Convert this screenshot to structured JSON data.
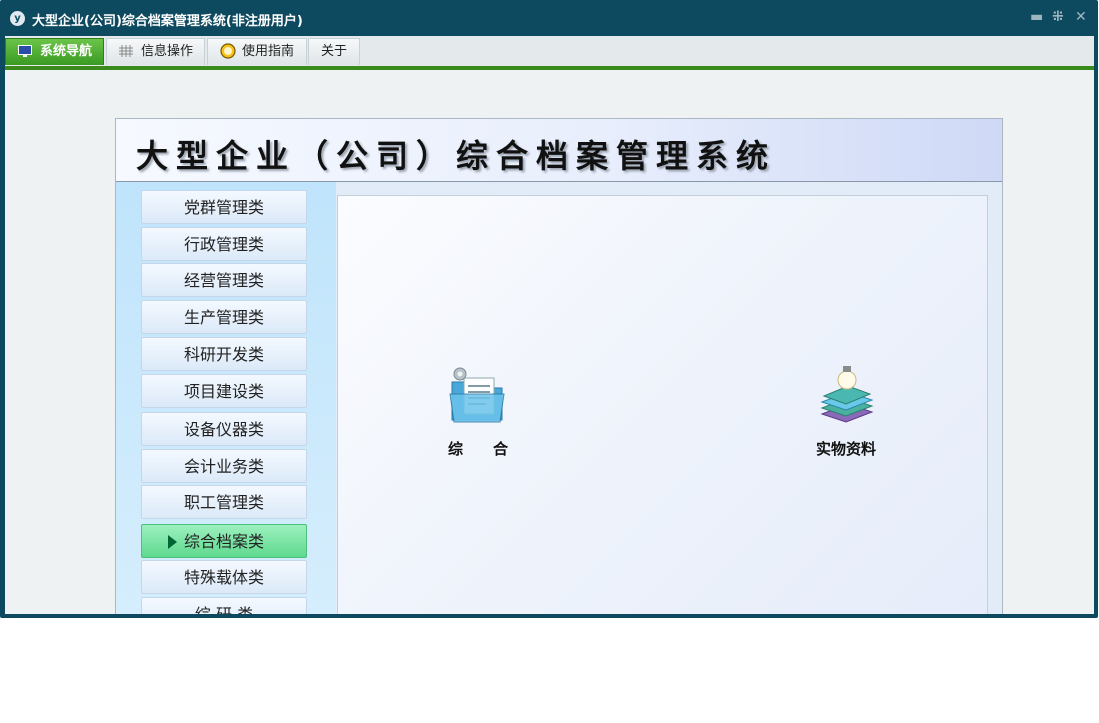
{
  "window": {
    "title": "大型企业(公司)综合档案管理系统(非注册用户)",
    "logo_text": "y",
    "controls": {
      "minimize": "▬",
      "restore": "⁜",
      "close": "✕"
    }
  },
  "menubar": {
    "tabs": [
      {
        "label": "系统导航",
        "icon": "monitor-icon",
        "active": true
      },
      {
        "label": "信息操作",
        "icon": "grid-icon",
        "active": false
      },
      {
        "label": "使用指南",
        "icon": "clock-icon",
        "active": false
      },
      {
        "label": "关于",
        "icon": "",
        "active": false
      }
    ]
  },
  "header": {
    "title": "大型企业（公司）综合档案管理系统"
  },
  "sidebar": {
    "items": [
      {
        "label": "党群管理类"
      },
      {
        "label": "行政管理类"
      },
      {
        "label": "经营管理类"
      },
      {
        "label": "生产管理类"
      },
      {
        "label": "科研开发类"
      },
      {
        "label": "项目建设类"
      },
      {
        "label": "设备仪器类"
      },
      {
        "label": "会计业务类"
      },
      {
        "label": "职工管理类"
      },
      {
        "label": "综合档案类",
        "selected": true
      },
      {
        "label": "特殊载体类"
      },
      {
        "label": "综 研 类"
      }
    ]
  },
  "content": {
    "items": [
      {
        "label": "综　　合",
        "icon": "folder-document-icon"
      },
      {
        "label": "实物资料",
        "icon": "books-lightbulb-icon"
      }
    ]
  },
  "colors": {
    "window_frame": "#0e4a5f",
    "active_tab": "#3a9a22",
    "selected_nav": "#5fd98f",
    "sidebar_bg": "#bfe4fb"
  }
}
